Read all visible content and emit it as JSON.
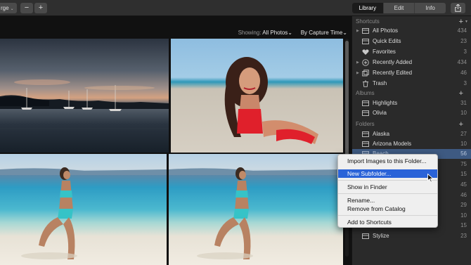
{
  "toolbar": {
    "zoom_label": "rge",
    "zoom_out_label": "−",
    "zoom_in_label": "+",
    "tabs": [
      {
        "label": "Library",
        "active": true
      },
      {
        "label": "Edit",
        "active": false
      },
      {
        "label": "Info",
        "active": false
      }
    ],
    "share_icon": "share-icon"
  },
  "filter": {
    "showing_label": "Showing:",
    "showing_value": "All Photos",
    "sort_value": "By Capture Time"
  },
  "sidebar": {
    "shortcuts": {
      "title": "Shortcuts",
      "items": [
        {
          "label": "All Photos",
          "count": "434",
          "icon": "photos-icon",
          "expandable": true
        },
        {
          "label": "Quick Edits",
          "count": "23",
          "icon": "photos-icon",
          "expandable": false
        },
        {
          "label": "Favorites",
          "count": "3",
          "icon": "heart-icon",
          "expandable": false
        },
        {
          "label": "Recently Added",
          "count": "434",
          "icon": "add-circle-icon",
          "expandable": true
        },
        {
          "label": "Recently Edited",
          "count": "46",
          "icon": "edit-layers-icon",
          "expandable": true
        },
        {
          "label": "Trash",
          "count": "3",
          "icon": "trash-icon",
          "expandable": false
        }
      ]
    },
    "albums": {
      "title": "Albums",
      "items": [
        {
          "label": "Highlights",
          "count": "31",
          "icon": "album-icon"
        },
        {
          "label": "Olivia",
          "count": "10",
          "icon": "album-icon"
        }
      ]
    },
    "folders": {
      "title": "Folders",
      "items": [
        {
          "label": "Alaska",
          "count": "27",
          "icon": "folder-icon"
        },
        {
          "label": "Arizona Models",
          "count": "10",
          "icon": "folder-icon"
        },
        {
          "label": "Beach",
          "count": "56",
          "icon": "folder-icon",
          "selected": true
        },
        {
          "label": "",
          "count": "75",
          "icon": "folder-icon"
        },
        {
          "label": "",
          "count": "15",
          "icon": "folder-icon"
        },
        {
          "label": "",
          "count": "45",
          "icon": "folder-icon"
        },
        {
          "label": "",
          "count": "46",
          "icon": "folder-icon"
        },
        {
          "label": "",
          "count": "29",
          "icon": "folder-icon"
        },
        {
          "label": "",
          "count": "10",
          "icon": "folder-icon"
        },
        {
          "label": "",
          "count": "15",
          "icon": "folder-icon"
        },
        {
          "label": "Stylize",
          "count": "23",
          "icon": "folder-icon"
        }
      ]
    }
  },
  "context_menu": {
    "items": [
      {
        "label": "Import Images to this Folder...",
        "highlighted": false
      },
      {
        "label": "New Subfolder...",
        "highlighted": true
      },
      {
        "label": "Show in Finder",
        "highlighted": false
      },
      {
        "label": "Rename...",
        "highlighted": false
      },
      {
        "label": "Remove from Catalog",
        "highlighted": false
      },
      {
        "label": "Add to Shortcuts",
        "highlighted": false
      }
    ],
    "highlight_color": "#2a63d8"
  },
  "colors": {
    "selected_row": "#3e5a82",
    "sidebar_bg": "#2a2a2a",
    "toolbar_bg": "#2f2f2f"
  }
}
